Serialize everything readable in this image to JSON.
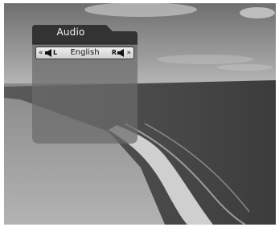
{
  "audio_menu": {
    "title": "Audio",
    "channel_left": "L",
    "language": "English",
    "channel_right": "R",
    "left_arrow_icon": "double-chevron-left-icon",
    "right_arrow_icon": "double-chevron-right-icon",
    "left_speaker_icon": "speaker-icon",
    "right_speaker_icon": "speaker-icon"
  },
  "colors": {
    "panel_header": "#333333",
    "panel_body": "#6b6b6b",
    "selector_bar": "#dcdcdc",
    "text_light": "#f4f4f4",
    "text_dark": "#111111"
  }
}
